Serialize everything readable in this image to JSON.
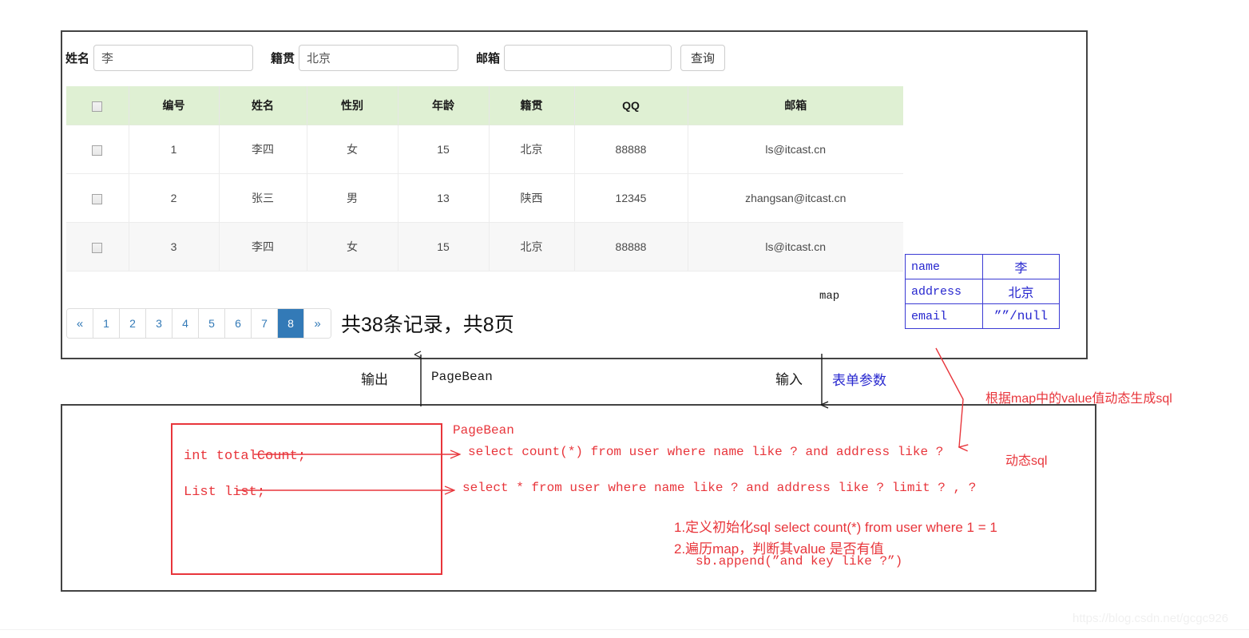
{
  "search_form": {
    "name_label": "姓名",
    "name_value": "李",
    "name_placeholder": "",
    "address_label": "籍贯",
    "address_value": "北京",
    "address_placeholder": "",
    "email_label": "邮箱",
    "email_value": "",
    "email_placeholder": "",
    "query_button": "查询"
  },
  "table": {
    "columns": [
      "",
      "编号",
      "姓名",
      "性别",
      "年龄",
      "籍贯",
      "QQ",
      "邮箱"
    ],
    "rows": [
      {
        "id": "1",
        "name": "李四",
        "gender": "女",
        "age": "15",
        "address": "北京",
        "qq": "88888",
        "email": "ls@itcast.cn"
      },
      {
        "id": "2",
        "name": "张三",
        "gender": "男",
        "age": "13",
        "address": "陕西",
        "qq": "12345",
        "email": "zhangsan@itcast.cn"
      },
      {
        "id": "3",
        "name": "李四",
        "gender": "女",
        "age": "15",
        "address": "北京",
        "qq": "88888",
        "email": "ls@itcast.cn"
      }
    ]
  },
  "pagination": {
    "prev": "«",
    "pages": [
      "1",
      "2",
      "3",
      "4",
      "5",
      "6",
      "7",
      "8"
    ],
    "active_page": "8",
    "next": "»",
    "record_info": "共38条记录，共8页",
    "accent_color": "#337ab7"
  },
  "map_box": {
    "caption": "map",
    "rows": [
      {
        "key": "name",
        "value": "李"
      },
      {
        "key": "address",
        "value": "北京"
      },
      {
        "key": "email",
        "value": "””/null"
      }
    ],
    "border_color": "#3b3bd4"
  },
  "connectors": {
    "output_label": "输出",
    "output_value": "PageBean",
    "input_label": "输入",
    "input_value": "表单参数",
    "red_note": "根据map中的value值动态生成sql",
    "red_color": "#e8353b",
    "blue_color": "#2727cf"
  },
  "bottom_panel": {
    "fields": [
      "int totalCount;",
      "List list;"
    ],
    "pagebean_title": "PageBean",
    "sql_count": "select count(*) from user where name like ? and address like ?",
    "sql_list": "select * from user where name like ? and address like ? limit ? , ?",
    "dynamic_sql_label": "动态sql",
    "steps": [
      "1.定义初始化sql select count(*) from user where 1 = 1",
      "2.遍历map，判断其value 是否有值",
      "sb.append(”and  key like ?”)"
    ]
  },
  "watermark": {
    "text": "https://blog.csdn.net/gcgc926"
  }
}
